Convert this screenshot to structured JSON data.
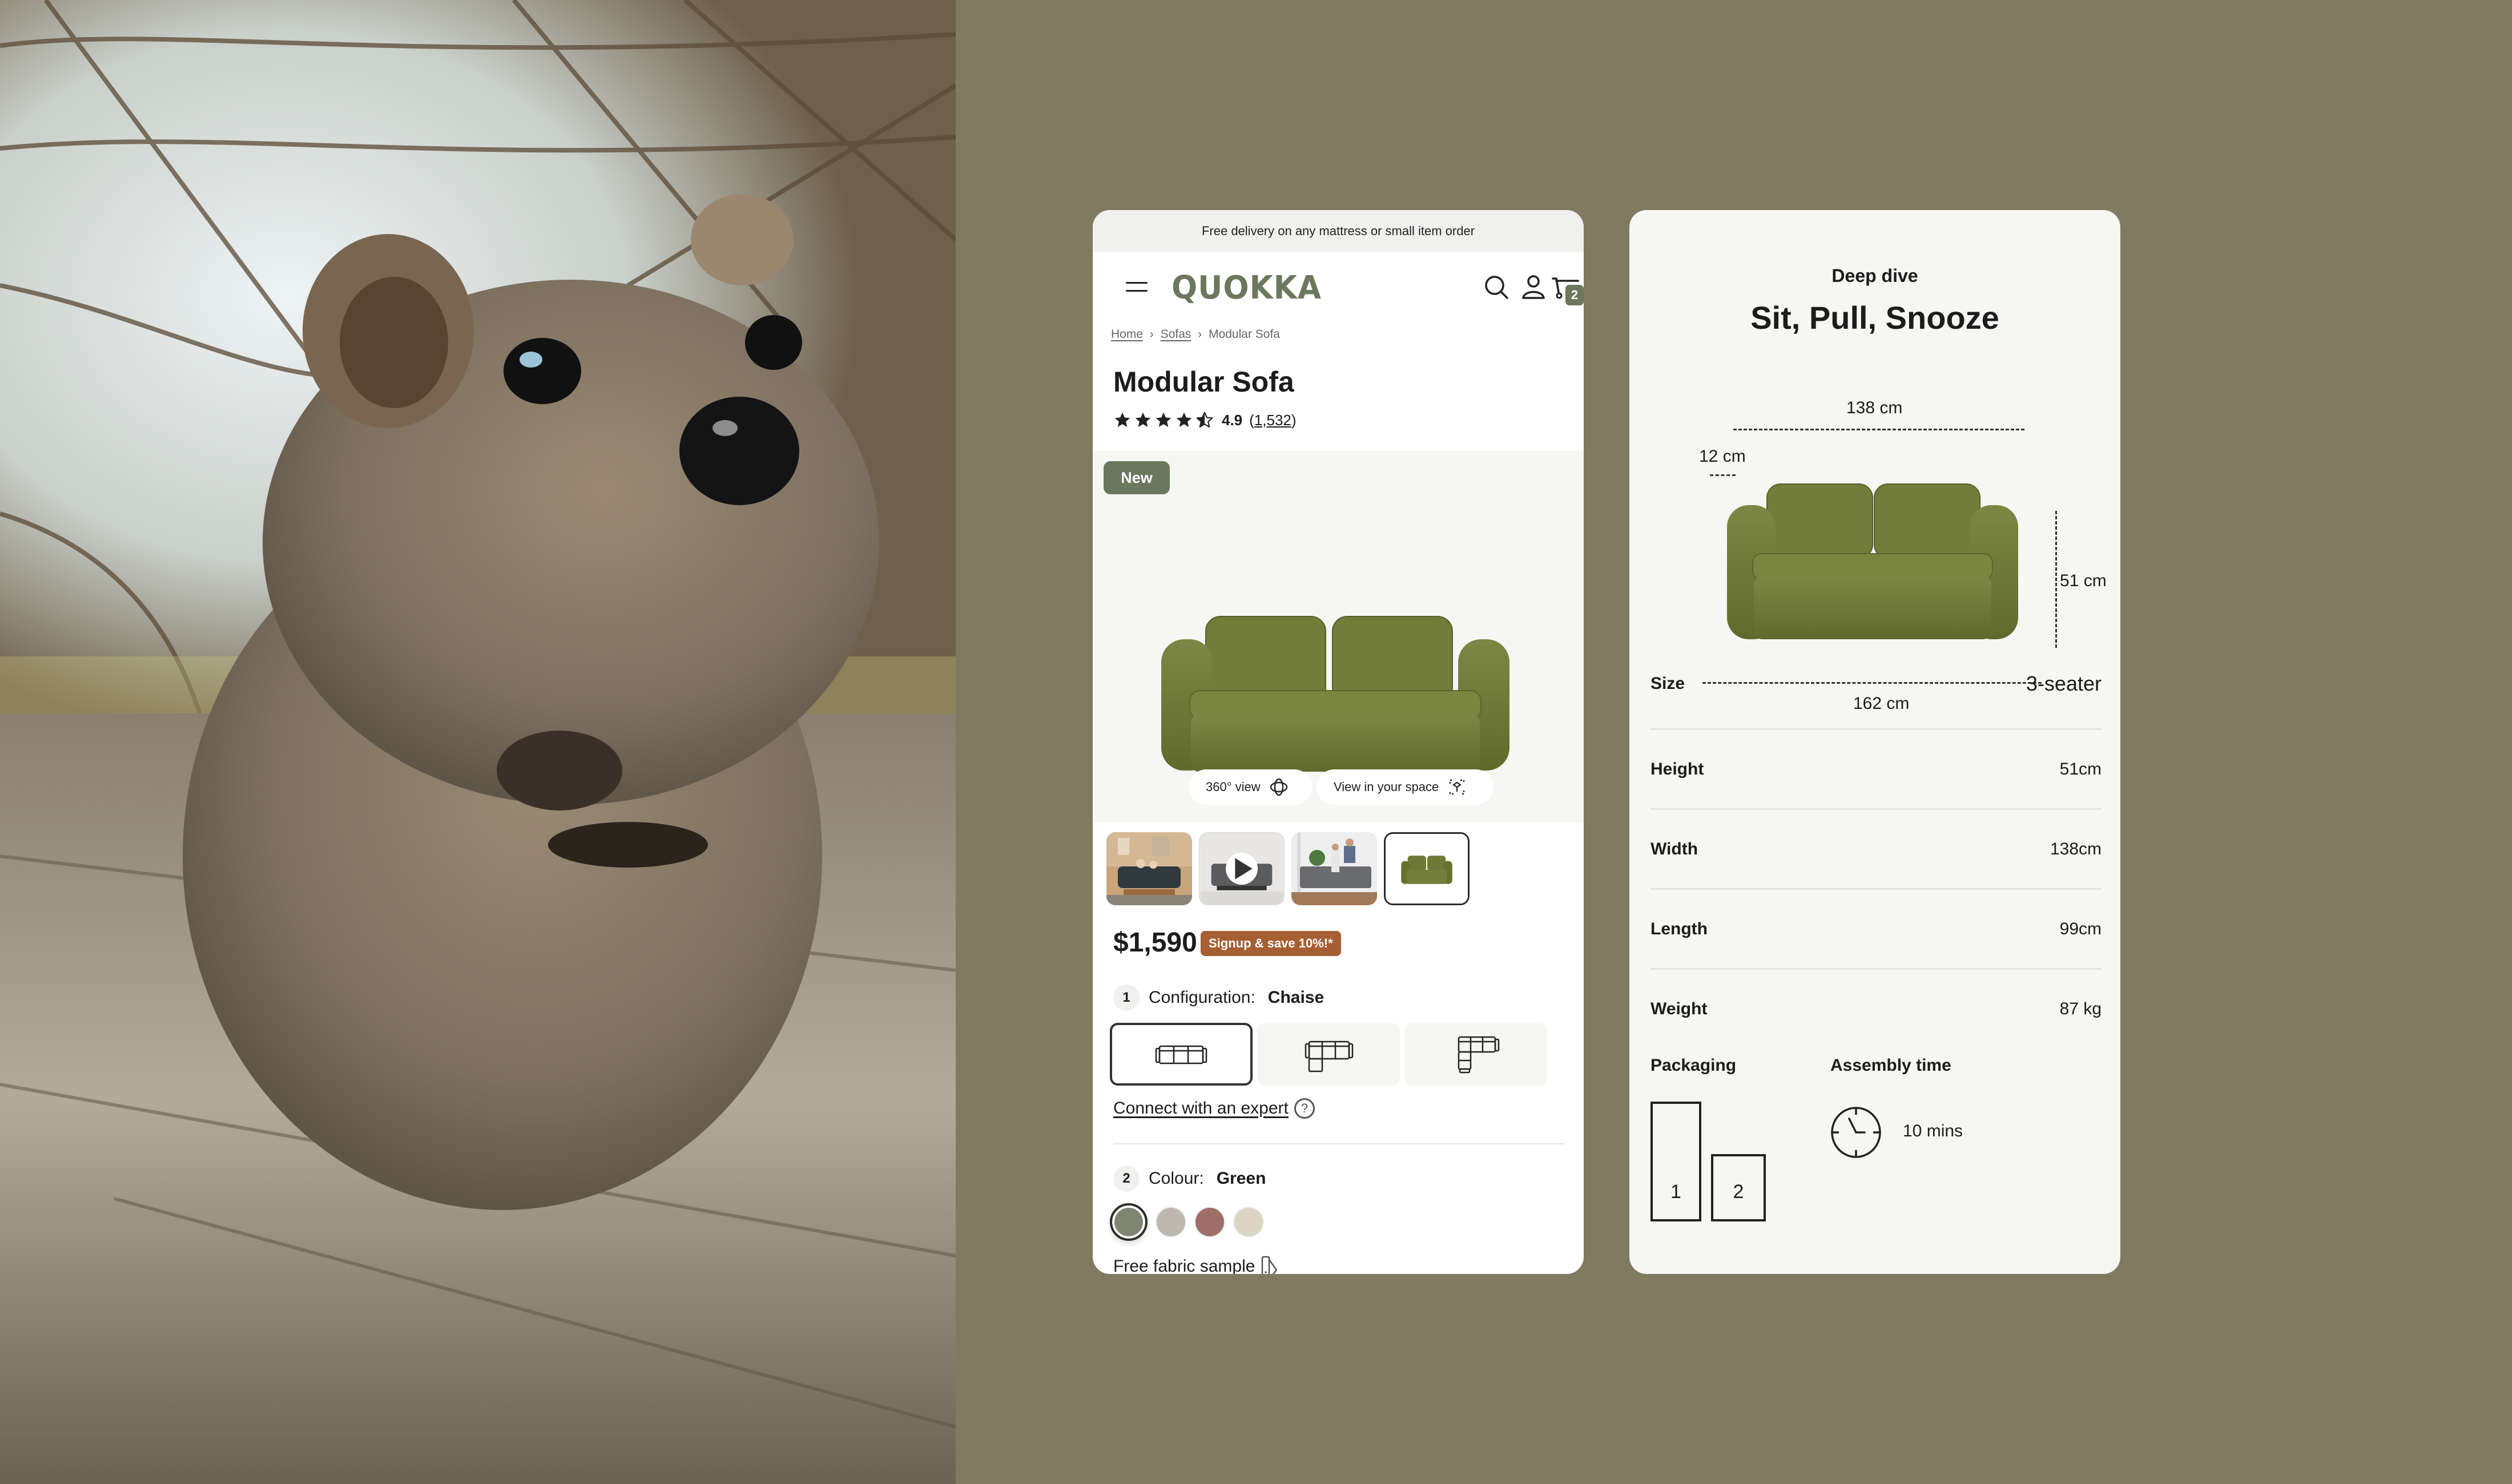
{
  "photo": {
    "subject": "quokka",
    "description": "Close-up photo of a quokka on a log in front of sunlit branches"
  },
  "product_page": {
    "banner": "Free delivery on any mattress or small item order",
    "header": {
      "logo": "QUOKKA",
      "menu_icon": "hamburger-icon",
      "search_icon": "search-icon",
      "account_icon": "user-icon",
      "cart_icon": "cart-icon",
      "cart_count": "2"
    },
    "breadcrumb": [
      {
        "label": "Home",
        "link": true
      },
      {
        "label": "Sofas",
        "link": true
      },
      {
        "label": "Modular Sofa",
        "link": false
      }
    ],
    "breadcrumb_separator": "›",
    "title": "Modular Sofa",
    "rating": {
      "stars": 4.5,
      "score": "4.9",
      "count_open": "(",
      "count": "1,532",
      "count_close": ")"
    },
    "gallery": {
      "badge": "New",
      "actions": [
        {
          "label": "360° view",
          "icon": "rotate-360-icon"
        },
        {
          "label": "View in your space",
          "icon": "ar-view-icon"
        }
      ],
      "thumbnails": [
        {
          "alt": "Couple on dark sofa in living room",
          "type": "image",
          "selected": false
        },
        {
          "alt": "Grey sofa video",
          "type": "video",
          "selected": false
        },
        {
          "alt": "Father and child with grey sofa",
          "type": "image",
          "selected": false
        },
        {
          "alt": "Green modular sofa",
          "type": "image",
          "selected": true
        }
      ]
    },
    "price": "$1,590",
    "promo": "Signup & save 10%!*",
    "configuration": {
      "step": "1",
      "label": "Configuration:",
      "value": "Chaise",
      "options": [
        {
          "name": "3-seater",
          "selected": true
        },
        {
          "name": "chaise",
          "selected": false
        },
        {
          "name": "corner",
          "selected": false
        }
      ]
    },
    "expert_link": "Connect with an expert",
    "help_icon": "?",
    "colour": {
      "step": "2",
      "label": "Colour:",
      "value": "Green",
      "swatches": [
        {
          "name": "Green",
          "hex": "#7F8570",
          "selected": true
        },
        {
          "name": "Grey",
          "hex": "#BDB9AF",
          "selected": false
        },
        {
          "name": "Rose",
          "hex": "#9E6F69",
          "selected": false
        },
        {
          "name": "Beige",
          "hex": "#DDD5C4",
          "selected": false
        }
      ]
    },
    "fabric_sample": "Free fabric sample"
  },
  "deep_dive": {
    "eyebrow": "Deep dive",
    "title": "Sit, Pull, Snooze",
    "dimensions": {
      "top_width": "138 cm",
      "arm_width": "12 cm",
      "height": "51 cm",
      "total_width": "162 cm"
    },
    "specs": [
      {
        "label": "Size",
        "value": "3-seater"
      },
      {
        "label": "Height",
        "value": "51cm"
      },
      {
        "label": "Width",
        "value": "138cm"
      },
      {
        "label": "Length",
        "value": "99cm"
      },
      {
        "label": "Weight",
        "value": "87 kg"
      }
    ],
    "packaging": {
      "label": "Packaging",
      "boxes": [
        "1",
        "2"
      ]
    },
    "assembly": {
      "label": "Assembly time",
      "value": "10 mins"
    }
  },
  "colors": {
    "background": "#807A61",
    "brand_green": "#6B785E",
    "promo_orange": "#A65E33",
    "sofa_green": "#6F7A3A"
  }
}
